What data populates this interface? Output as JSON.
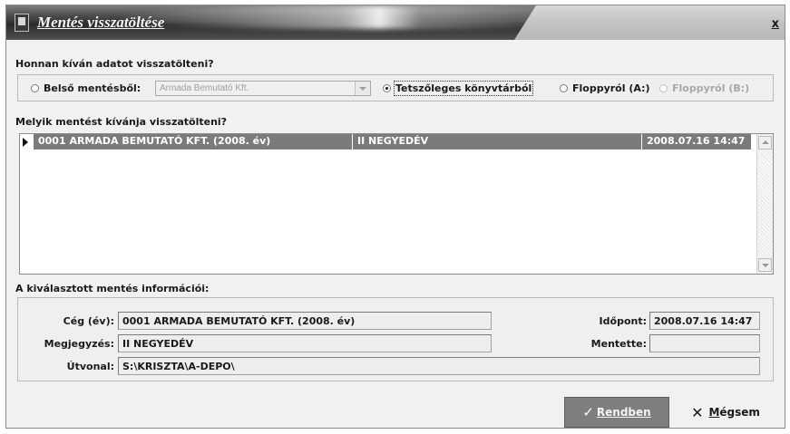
{
  "window": {
    "title": "Mentés visszatöltése",
    "close_label": "x"
  },
  "source": {
    "heading": "Honnan kíván adatot visszatölteni?",
    "options": [
      {
        "label": "Belső mentésből:",
        "selected": false,
        "enabled": true
      },
      {
        "label": "Tetszőleges könyvtárból",
        "selected": true,
        "enabled": true
      },
      {
        "label": "Floppyról (A:)",
        "selected": false,
        "enabled": true
      },
      {
        "label": "Floppyról (B:)",
        "selected": false,
        "enabled": false
      }
    ],
    "internal_combo_value": "Armada Bemutató Kft."
  },
  "backups": {
    "heading": "Melyik mentést kívánja visszatölteni?",
    "rows": [
      {
        "company": "0001 ARMADA BEMUTATÓ KFT. (2008. év)",
        "note": "II NEGYEDÉV",
        "datetime": "2008.07.16 14:47"
      }
    ]
  },
  "info": {
    "heading": "A kiválasztott mentés információi:",
    "company_label": "Cég (év):",
    "company_value": "0001 ARMADA BEMUTATÓ KFT. (2008. év)",
    "note_label": "Megjegyzés:",
    "note_value": "II NEGYEDÉV",
    "path_label": "Útvonal:",
    "path_value": "S:\\KRISZTA\\A-DEPO\\",
    "time_label": "Időpont:",
    "time_value": "2008.07.16 14:47",
    "saved_by_label": "Mentette:",
    "saved_by_value": ""
  },
  "buttons": {
    "ok_label": "Rendben",
    "cancel_label": "Mégsem"
  }
}
